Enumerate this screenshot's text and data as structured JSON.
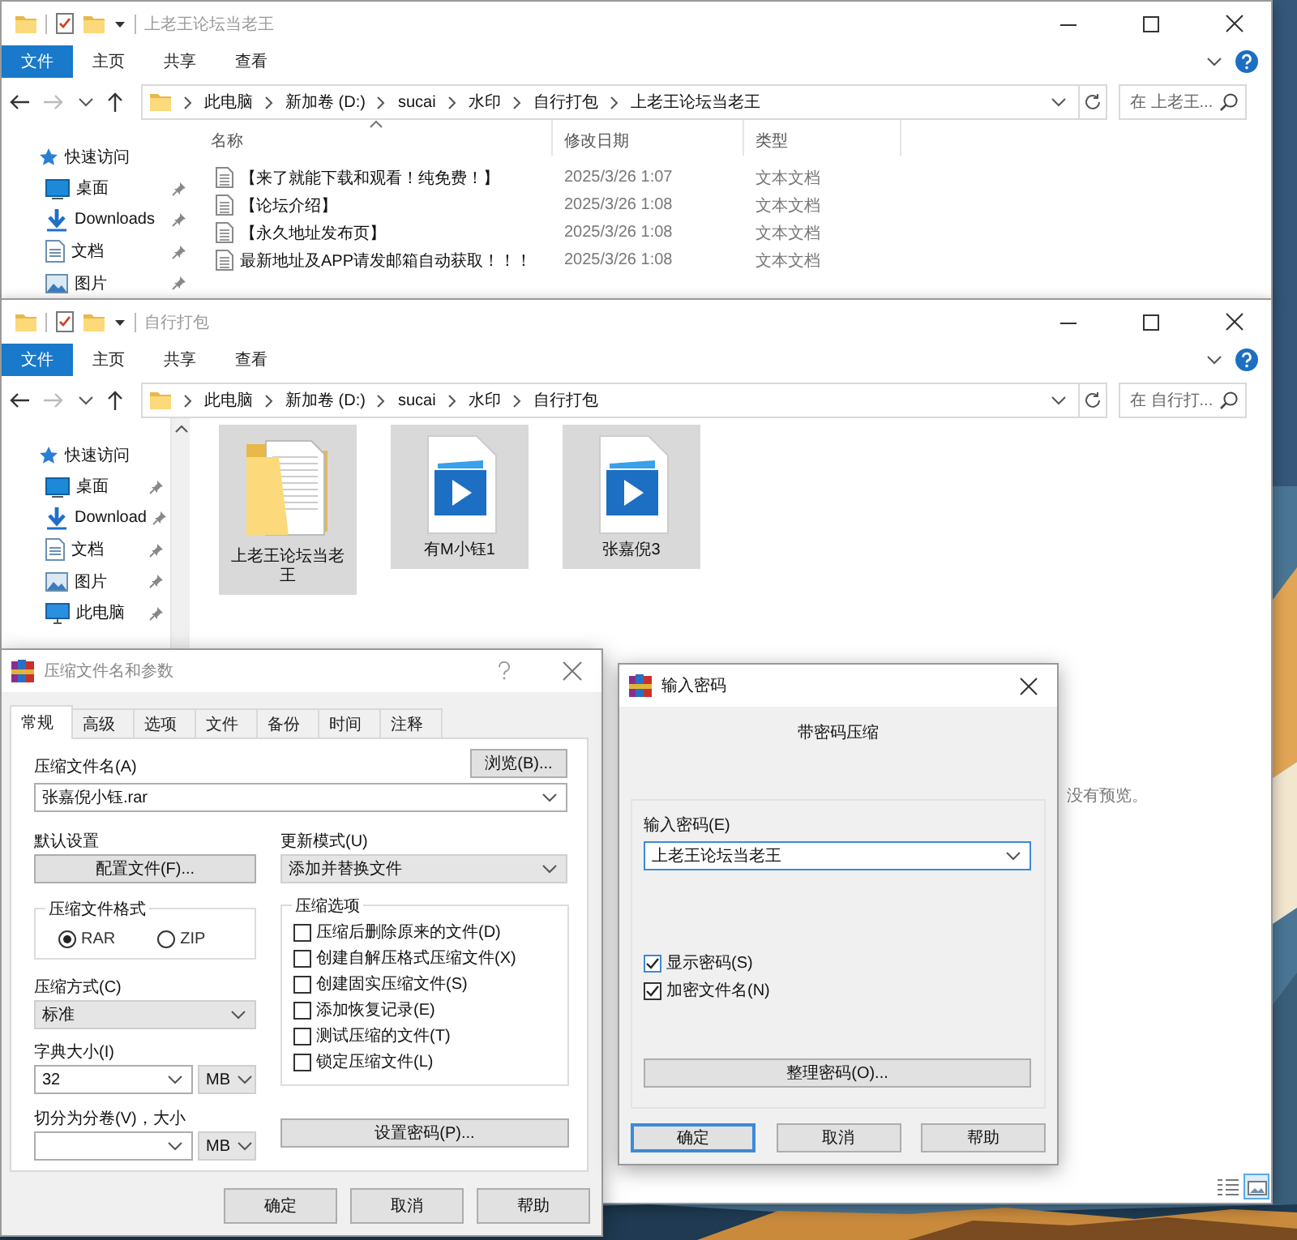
{
  "explorer_windows": [
    {
      "title": "上老王论坛当老王",
      "ribbon_tabs": [
        {
          "label": "文件",
          "selected": true
        },
        {
          "label": "主页",
          "selected": false
        },
        {
          "label": "共享",
          "selected": false
        },
        {
          "label": "查看",
          "selected": false
        }
      ],
      "path": [
        "此电脑",
        "新加卷 (D:)",
        "sucai",
        "水印",
        "自行打包",
        "上老王论坛当老王"
      ],
      "search": {
        "placeholder": "在 上老王..."
      },
      "sidebar": [
        {
          "label": "快速访问",
          "kind": "quick_access",
          "pinned": false
        },
        {
          "label": "桌面",
          "kind": "desktop",
          "pinned": true
        },
        {
          "label": "Downloads",
          "kind": "downloads",
          "pinned": true
        },
        {
          "label": "文档",
          "kind": "documents",
          "pinned": true
        },
        {
          "label": "图片",
          "kind": "pictures",
          "pinned": true
        }
      ],
      "columns": [
        {
          "label": "名称",
          "sorted": true
        },
        {
          "label": "修改日期",
          "sorted": false
        },
        {
          "label": "类型",
          "sorted": false
        }
      ],
      "files": [
        {
          "name": "【来了就能下载和观看！纯免费！】",
          "modified": "2025/3/26 1:07",
          "type": "文本文档"
        },
        {
          "name": "【论坛介绍】",
          "modified": "2025/3/26 1:08",
          "type": "文本文档"
        },
        {
          "name": "【永久地址发布页】",
          "modified": "2025/3/26 1:08",
          "type": "文本文档"
        },
        {
          "name": "最新地址及APP请发邮箱自动获取！！！",
          "modified": "2025/3/26 1:08",
          "type": "文本文档"
        }
      ]
    },
    {
      "title": "自行打包",
      "ribbon_tabs": [
        {
          "label": "文件",
          "selected": true
        },
        {
          "label": "主页",
          "selected": false
        },
        {
          "label": "共享",
          "selected": false
        },
        {
          "label": "查看",
          "selected": false
        }
      ],
      "path": [
        "此电脑",
        "新加卷 (D:)",
        "sucai",
        "水印",
        "自行打包"
      ],
      "search": {
        "placeholder": "在 自行打..."
      },
      "sidebar": [
        {
          "label": "快速访问",
          "kind": "quick_access",
          "pinned": false
        },
        {
          "label": "桌面",
          "kind": "desktop",
          "pinned": true
        },
        {
          "label": "Download",
          "kind": "downloads",
          "pinned": true
        },
        {
          "label": "文档",
          "kind": "documents",
          "pinned": true
        },
        {
          "label": "图片",
          "kind": "pictures",
          "pinned": true
        },
        {
          "label": "此电脑",
          "kind": "computer",
          "pinned": true
        }
      ],
      "items": [
        {
          "name": "上老王论坛当老王",
          "kind": "folder",
          "selected": true
        },
        {
          "name": "有M小钰1",
          "kind": "video",
          "selected": true
        },
        {
          "name": "张嘉倪3",
          "kind": "video",
          "selected": true
        }
      ],
      "preview": "没有预览。",
      "layout_buttons": [
        {
          "kind": "details",
          "selected": false
        },
        {
          "kind": "large_icons",
          "selected": true
        }
      ]
    }
  ],
  "archive_dialog": {
    "title": "压缩文件名和参数",
    "tabs": [
      {
        "label": "常规",
        "selected": true
      },
      {
        "label": "高级",
        "selected": false
      },
      {
        "label": "选项",
        "selected": false
      },
      {
        "label": "文件",
        "selected": false
      },
      {
        "label": "备份",
        "selected": false
      },
      {
        "label": "时间",
        "selected": false
      },
      {
        "label": "注释",
        "selected": false
      }
    ],
    "archive_name": {
      "label": "压缩文件名(A)",
      "value": "张嘉倪小钰.rar"
    },
    "browse_button": "浏览(B)...",
    "profiles": {
      "label": "默认设置",
      "button": "配置文件(F)..."
    },
    "update_mode": {
      "label": "更新模式(U)",
      "value": "添加并替换文件"
    },
    "format": {
      "title": "压缩文件格式",
      "options": [
        {
          "label": "RAR",
          "selected": true
        },
        {
          "label": "ZIP",
          "selected": false
        }
      ]
    },
    "method": {
      "label": "压缩方式(C)",
      "value": "标准"
    },
    "dictionary": {
      "label": "字典大小(I)",
      "value": "32",
      "unit": "MB"
    },
    "split": {
      "label": "切分为分卷(V)，大小",
      "unit": "MB"
    },
    "options": {
      "title": "压缩选项",
      "items": [
        {
          "label": "压缩后删除原来的文件(D)",
          "checked": false
        },
        {
          "label": "创建自解压格式压缩文件(X)",
          "checked": false
        },
        {
          "label": "创建固实压缩文件(S)",
          "checked": false
        },
        {
          "label": "添加恢复记录(E)",
          "checked": false
        },
        {
          "label": "测试压缩的文件(T)",
          "checked": false
        },
        {
          "label": "锁定压缩文件(L)",
          "checked": false
        }
      ]
    },
    "password_button": "设置密码(P)...",
    "buttons": [
      {
        "label": "确定",
        "default": false
      },
      {
        "label": "取消",
        "default": false
      },
      {
        "label": "帮助",
        "default": false
      }
    ]
  },
  "password_dialog": {
    "title": "输入密码",
    "heading": "带密码压缩",
    "password": {
      "label": "输入密码(E)",
      "value": "上老王论坛当老王"
    },
    "options": [
      {
        "label": "显示密码(S)",
        "checked": true
      },
      {
        "label": "加密文件名(N)",
        "checked": true
      }
    ],
    "organize_button": "整理密码(O)...",
    "buttons": [
      {
        "label": "确定",
        "default": true
      },
      {
        "label": "取消",
        "default": false
      },
      {
        "label": "帮助",
        "default": false
      }
    ]
  }
}
